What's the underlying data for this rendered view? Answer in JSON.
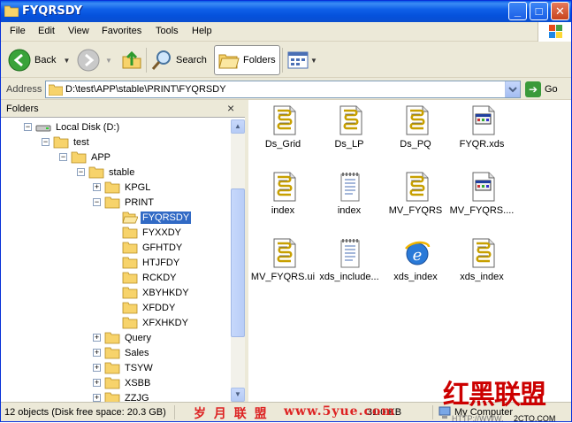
{
  "window": {
    "title": "FYQRSDY",
    "minimize_label": "_",
    "maximize_label": "□",
    "close_label": "✕"
  },
  "menu": [
    "File",
    "Edit",
    "View",
    "Favorites",
    "Tools",
    "Help"
  ],
  "toolbar": {
    "back_label": "Back",
    "search_label": "Search",
    "folders_label": "Folders"
  },
  "address": {
    "label": "Address",
    "value": "D:\\test\\APP\\stable\\PRINT\\FYQRSDY",
    "go_label": "Go"
  },
  "folders_pane": {
    "title": "Folders",
    "close_label": "×",
    "tree": [
      {
        "label": "Local Disk (D:)",
        "level": 0,
        "expander": "−",
        "icon": "drive-icon"
      },
      {
        "label": "test",
        "level": 1,
        "expander": "−",
        "icon": "folder-icon"
      },
      {
        "label": "APP",
        "level": 2,
        "expander": "−",
        "icon": "folder-icon"
      },
      {
        "label": "stable",
        "level": 3,
        "expander": "−",
        "icon": "folder-icon"
      },
      {
        "label": "KPGL",
        "level": 4,
        "expander": "+",
        "icon": "folder-icon"
      },
      {
        "label": "PRINT",
        "level": 4,
        "expander": "−",
        "icon": "folder-icon"
      },
      {
        "label": "FYQRSDY",
        "level": 5,
        "expander": "",
        "icon": "folder-open-icon",
        "selected": true
      },
      {
        "label": "FYXXDY",
        "level": 5,
        "expander": "",
        "icon": "folder-icon"
      },
      {
        "label": "GFHTDY",
        "level": 5,
        "expander": "",
        "icon": "folder-icon"
      },
      {
        "label": "HTJFDY",
        "level": 5,
        "expander": "",
        "icon": "folder-icon"
      },
      {
        "label": "RCKDY",
        "level": 5,
        "expander": "",
        "icon": "folder-icon"
      },
      {
        "label": "XBYHKDY",
        "level": 5,
        "expander": "",
        "icon": "folder-icon"
      },
      {
        "label": "XFDDY",
        "level": 5,
        "expander": "",
        "icon": "folder-icon"
      },
      {
        "label": "XFXHKDY",
        "level": 5,
        "expander": "",
        "icon": "folder-icon"
      },
      {
        "label": "Query",
        "level": 4,
        "expander": "+",
        "icon": "folder-icon"
      },
      {
        "label": "Sales",
        "level": 4,
        "expander": "+",
        "icon": "folder-icon"
      },
      {
        "label": "TSYW",
        "level": 4,
        "expander": "+",
        "icon": "folder-icon"
      },
      {
        "label": "XSBB",
        "level": 4,
        "expander": "+",
        "icon": "folder-icon"
      },
      {
        "label": "ZZJG",
        "level": 4,
        "expander": "+",
        "icon": "folder-icon"
      }
    ]
  },
  "files": [
    {
      "label": "Ds_Grid",
      "icon": "script-icon"
    },
    {
      "label": "Ds_LP",
      "icon": "script-icon"
    },
    {
      "label": "Ds_PQ",
      "icon": "script-icon"
    },
    {
      "label": "FYQR.xds",
      "icon": "xds-file-icon"
    },
    {
      "label": "index",
      "icon": "script-icon"
    },
    {
      "label": "index",
      "icon": "text-file-icon"
    },
    {
      "label": "MV_FYQRS",
      "icon": "script-icon"
    },
    {
      "label": "MV_FYQRS....",
      "icon": "xds-file-icon"
    },
    {
      "label": "MV_FYQRS.ui",
      "icon": "script-icon"
    },
    {
      "label": "xds_include...",
      "icon": "text-file-icon"
    },
    {
      "label": "xds_index",
      "icon": "ie-html-icon"
    },
    {
      "label": "xds_index",
      "icon": "script-icon"
    }
  ],
  "status": {
    "objects": "12 objects (Disk free space: 20.3 GB)",
    "size": "31.0 KB",
    "location": "My Computer"
  },
  "watermarks": {
    "left_cn": "岁 月 联 盟",
    "url": "www.5yue.com",
    "big_cn": "红黑联盟",
    "site": "2CTO.COM",
    "http": "HTTP://WWW."
  }
}
